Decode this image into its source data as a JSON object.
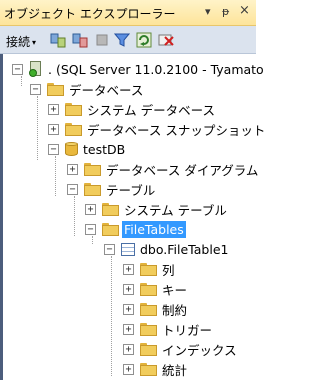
{
  "window": {
    "title": "オブジェクト エクスプローラー"
  },
  "titlebar_icons": {
    "dropdown": "▾",
    "pin": "ᵽ",
    "close": "×"
  },
  "toolbar": {
    "connect_label": "接続",
    "connect_arrow": "▾",
    "icons": [
      "connect-object-icon",
      "disconnect-icon",
      "stop-icon",
      "filter-icon",
      "refresh-icon",
      "clear-filter-icon"
    ]
  },
  "tree": {
    "server": ". (SQL Server 11.0.2100 - Tyamato",
    "databases": "データベース",
    "system_databases": "システム データベース",
    "snapshots": "データベース スナップショット",
    "testdb": "testDB",
    "diagrams": "データベース ダイアグラム",
    "tables": "テーブル",
    "system_tables": "システム テーブル",
    "filetables": "FileTables",
    "filetable1": "dbo.FileTable1",
    "columns": "列",
    "keys": "キー",
    "constraints": "制約",
    "triggers": "トリガー",
    "indexes": "インデックス",
    "statistics": "統計"
  },
  "expanders": {
    "collapse": "−",
    "expand": "+"
  },
  "colors": {
    "selection": "#3399ff",
    "title_gradient": "#fde49a",
    "folder": "#f1cc5c"
  }
}
